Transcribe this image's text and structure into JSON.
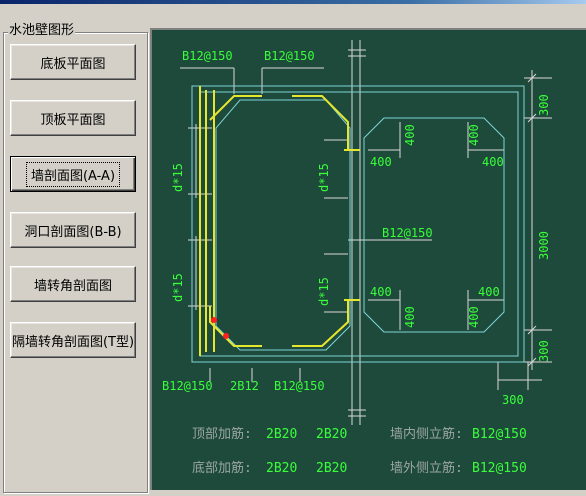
{
  "panel": {
    "title": "水池壁图形",
    "buttons": [
      {
        "label": "底板平面图"
      },
      {
        "label": "顶板平面图"
      },
      {
        "label": "墙剖面图(A-A)"
      },
      {
        "label": "洞口剖面图(B-B)"
      },
      {
        "label": "墙转角剖面图"
      },
      {
        "label": "隔墙转角剖面图(T型)"
      }
    ]
  },
  "drawing": {
    "labels": {
      "rebar_top_left": "B12@150",
      "rebar_top_right": "B12@150",
      "rebar_mid_right": "B12@150",
      "rebar_bottom_left": "B12@150",
      "rebar_bottom_mid": "2B12",
      "rebar_bottom_right": "B12@150",
      "spacing_upper": "d*15",
      "spacing_lower": "d*15",
      "spacing_upper_inner": "d*15",
      "spacing_lower_inner": "d*15",
      "dim_400": "400",
      "dim_300": "300",
      "dim_3000": "3000"
    },
    "summary": {
      "top_label": "顶部加筋:",
      "top_v1": "2B20",
      "top_v2": "2B20",
      "bottom_label": "底部加筋:",
      "bottom_v1": "2B20",
      "bottom_v2": "2B20",
      "inner_label": "墙内侧立筋:",
      "inner_value": "B12@150",
      "outer_label": "墙外侧立筋:",
      "outer_value": "B12@150"
    },
    "colors": {
      "background": "#1e4a3c",
      "rebar": "#e6e62e",
      "outline": "#7ed6d6",
      "dimension": "#d8d8d8",
      "dim_text": "#39ff39",
      "summary_label": "#9aa6a0",
      "summary_value": "#39ff39",
      "marker": "#ff2020"
    }
  }
}
